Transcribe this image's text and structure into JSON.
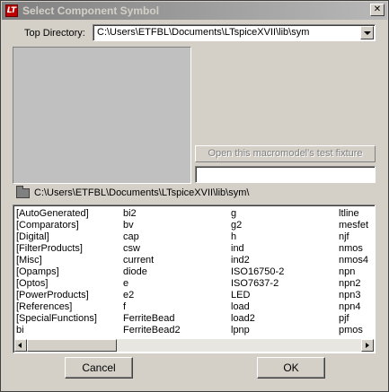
{
  "window": {
    "title": "Select Component Symbol",
    "close_glyph": "✕",
    "app_icon_glyph": "LT"
  },
  "top_directory": {
    "label": "Top Directory:",
    "value": "C:\\Users\\ETFBL\\Documents\\LTspiceXVII\\lib\\sym"
  },
  "test_fixture": {
    "button_label": "Open this macromodel's test fixture",
    "field_value": ""
  },
  "current_path": "C:\\Users\\ETFBL\\Documents\\LTspiceXVII\\lib\\sym\\",
  "listing": {
    "columns": [
      [
        "[AutoGenerated]",
        "[Comparators]",
        "[Digital]",
        "[FilterProducts]",
        "[Misc]",
        "[Opamps]",
        "[Optos]",
        "[PowerProducts]",
        "[References]",
        "[SpecialFunctions]",
        "bi"
      ],
      [
        "bi2",
        "bv",
        "cap",
        "csw",
        "current",
        "diode",
        "e",
        "e2",
        "f",
        "FerriteBead",
        "FerriteBead2"
      ],
      [
        "g",
        "g2",
        "h",
        "ind",
        "ind2",
        "ISO16750-2",
        "ISO7637-2",
        "LED",
        "load",
        "load2",
        "lpnp"
      ],
      [
        "ltline",
        "mesfet",
        "njf",
        "nmos",
        "nmos4",
        "npn",
        "npn2",
        "npn3",
        "npn4",
        "pjf",
        "pmos"
      ]
    ]
  },
  "buttons": {
    "cancel": "Cancel",
    "ok": "OK"
  },
  "icons": {
    "folder": "folder-icon",
    "dropdown": "chevron-down-icon"
  }
}
